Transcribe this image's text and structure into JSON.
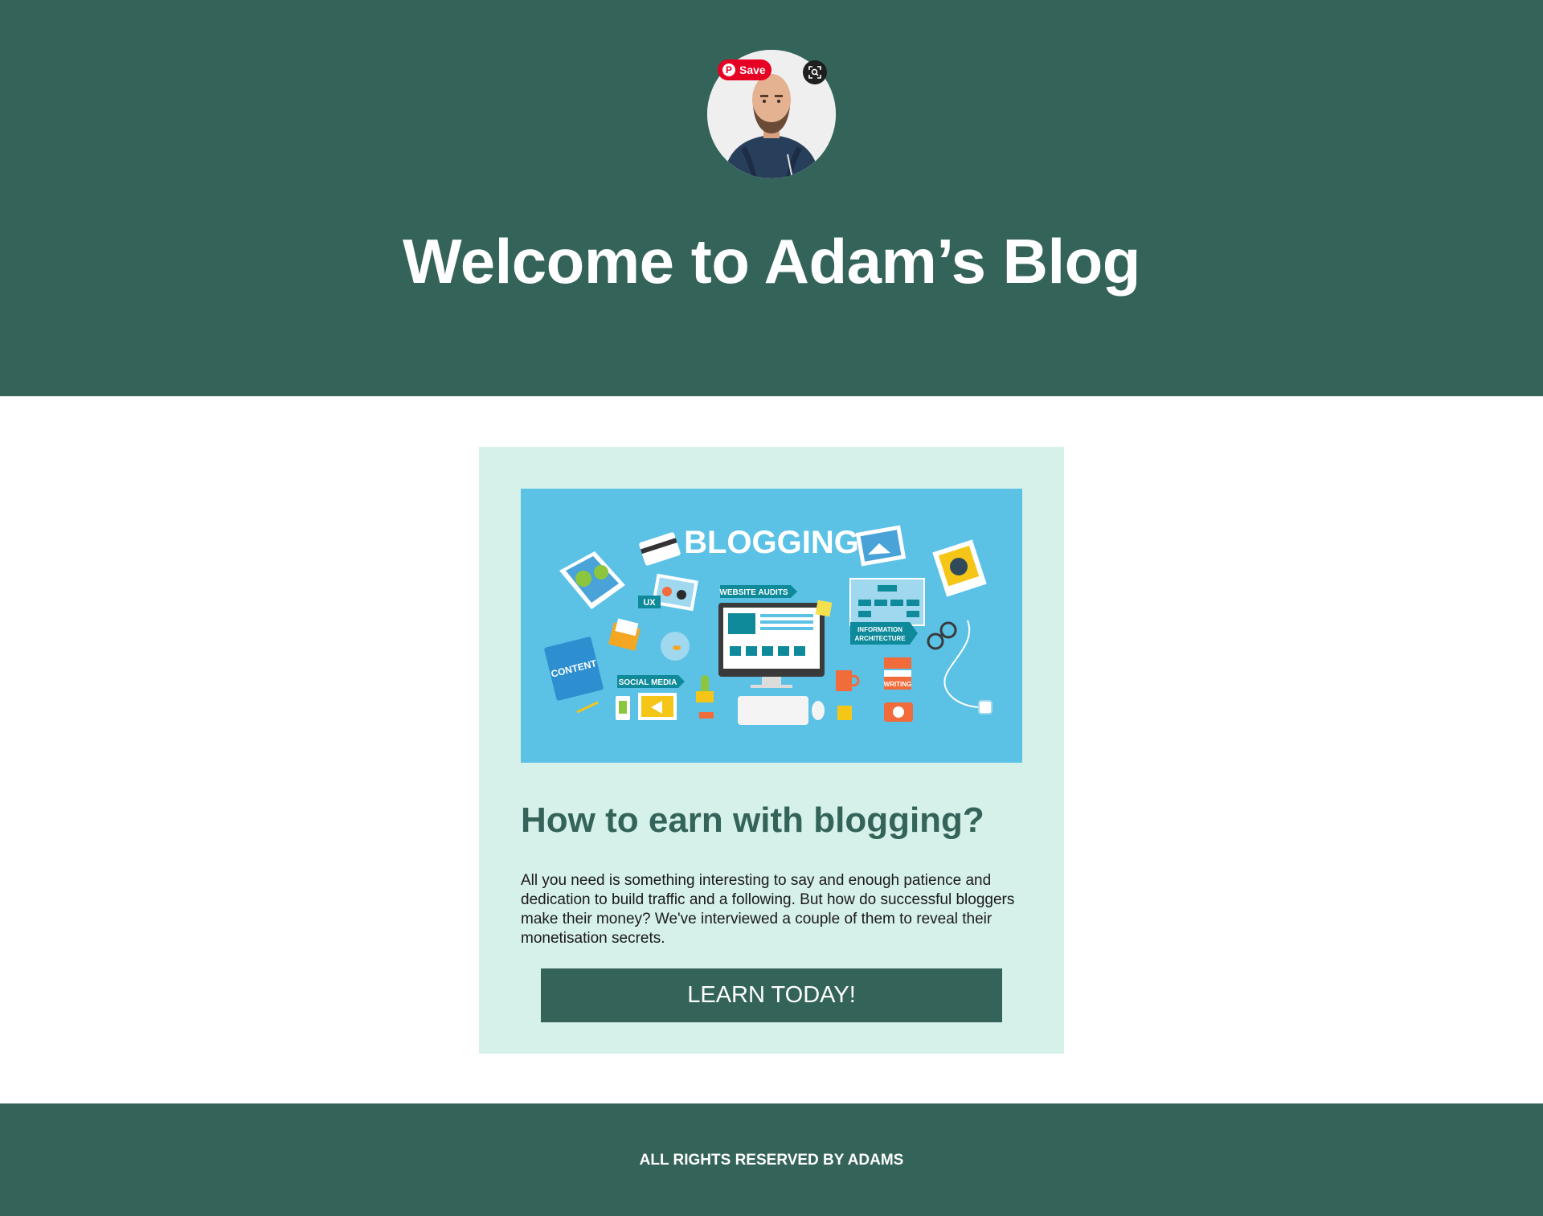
{
  "hero": {
    "title": "Welcome to Adam’s Blog",
    "background_color": "#346459",
    "pin_save_label": "Save",
    "pin_logo": "P",
    "pin_color": "#e60023",
    "lens_icon": "visual-search-icon"
  },
  "card": {
    "background_color": "#d6f0ea",
    "image": {
      "title": "BLOGGING",
      "labels": {
        "ux": "UX",
        "website_audits": "WEBSITE AUDITS",
        "info_arch_line1": "INFORMATION",
        "info_arch_line2": "ARCHITECTURE",
        "content": "CONTENT",
        "social_media": "SOCIAL MEDIA",
        "writing": "WRITING"
      }
    },
    "heading": "How to earn with blogging?",
    "text": "All you need is something interesting to say and enough patience and dedication to build traffic and a following. But how do successful bloggers make their money? We've interviewed a couple of them to reveal their monetisation secrets.",
    "button_label": "LEARN TODAY!"
  },
  "footer": {
    "text": "ALL RIGHTS RESERVED BY ADAMS"
  }
}
